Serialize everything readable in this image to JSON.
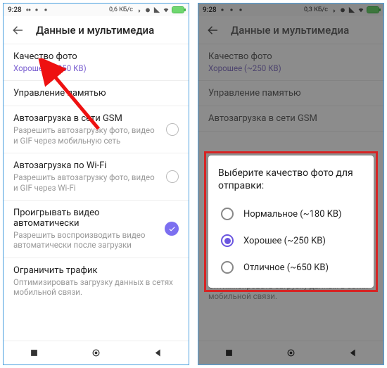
{
  "status": {
    "time": "9:28",
    "net1": "0,6 КБ/с",
    "net2": "0,3 КБ/с",
    "battery": "100"
  },
  "header": {
    "title": "Данные и мультимедиа"
  },
  "settings": {
    "photo_quality": {
      "title": "Качество фото",
      "value": "Хорошее (~250 КВ)"
    },
    "memory": {
      "title": "Управление памятью"
    },
    "gsm": {
      "title": "Автозагрузка в сети GSM",
      "sub": "Разрешить автозагрузку фото, видео и GIF через мобильную сеть",
      "sub_short": "Разрешить автозагрузку"
    },
    "wifi": {
      "title": "Автозагрузка по Wi-Fi",
      "sub": "Разрешить автозагрузку фото, видео и GIF через Wi-Fi"
    },
    "autoplay": {
      "title": "Проигрывать видео автоматически",
      "sub": "Разрешить воспроизводить видео автоматически после загрузки"
    },
    "traffic": {
      "title": "Ограничить трафик",
      "sub": "Оптимизировать загрузку данных в сетях мобильной связи."
    }
  },
  "dialog": {
    "title": "Выберите качество фото для отправки:",
    "options": [
      {
        "label": "Нормальное (~180 KB)",
        "selected": false
      },
      {
        "label": "Хорошее (~250 KB)",
        "selected": true
      },
      {
        "label": "Отличное (~650 KB)",
        "selected": false
      }
    ]
  }
}
